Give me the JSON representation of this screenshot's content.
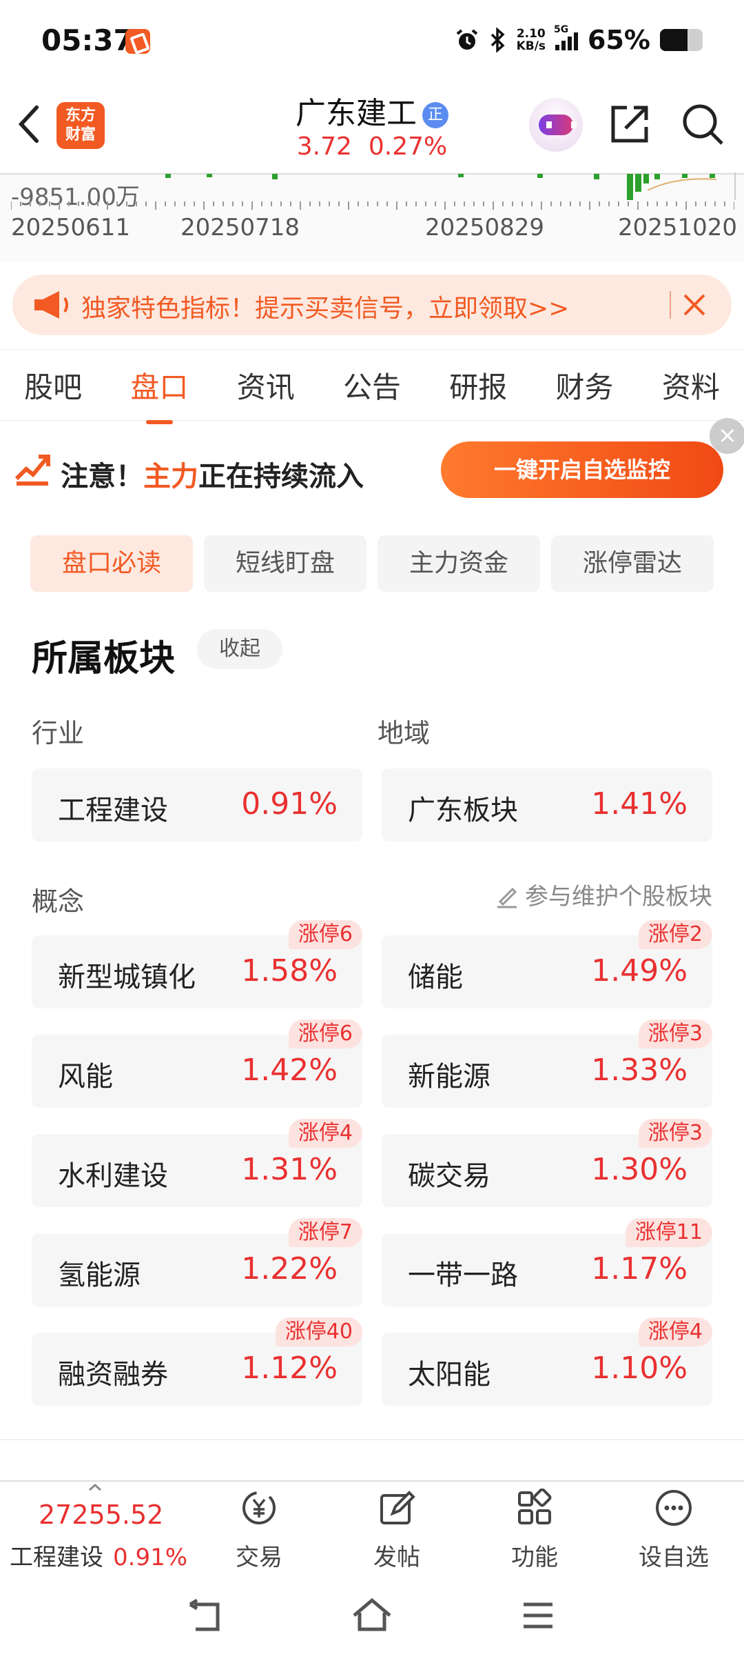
{
  "status_bar": {
    "time": "05:37",
    "net_speed_value": "2.10",
    "net_speed_unit": "KB/s",
    "network": "5G",
    "battery": "65%",
    "battery_level": 0.65
  },
  "header": {
    "logo_line1": "东方",
    "logo_line2": "财富",
    "stock_name": "广东建工",
    "cert_badge": "正",
    "price": "3.72",
    "change_pct": "0.27%"
  },
  "chart_strip": {
    "value_label": "-9851.00万",
    "dates": [
      "20250611",
      "20250718",
      "20250829",
      "20251020"
    ]
  },
  "banner": {
    "text": "独家特色指标！提示买卖信号，立即领取>>"
  },
  "tabs": [
    {
      "label": "股吧",
      "active": false
    },
    {
      "label": "盘口",
      "active": true
    },
    {
      "label": "资讯",
      "active": false
    },
    {
      "label": "公告",
      "active": false
    },
    {
      "label": "研报",
      "active": false
    },
    {
      "label": "财务",
      "active": false
    },
    {
      "label": "资料",
      "active": false
    }
  ],
  "notice": {
    "prefix": "注意！",
    "highlight": "主力",
    "suffix": "正在持续流入",
    "button": "一键开启自选监控"
  },
  "sub_tabs": [
    {
      "label": "盘口必读",
      "active": true
    },
    {
      "label": "短线盯盘",
      "active": false
    },
    {
      "label": "主力资金",
      "active": false
    },
    {
      "label": "涨停雷达",
      "active": false
    }
  ],
  "sectors": {
    "title": "所属板块",
    "collapse": "收起",
    "industry_label": "行业",
    "region_label": "地域",
    "industry": {
      "name": "工程建设",
      "pct": "0.91%"
    },
    "region": {
      "name": "广东板块",
      "pct": "1.41%"
    },
    "concept_label": "概念",
    "maintain_link": "参与维护个股板块",
    "concepts": [
      {
        "name": "新型城镇化",
        "pct": "1.58%",
        "badge": "涨停6"
      },
      {
        "name": "储能",
        "pct": "1.49%",
        "badge": "涨停2"
      },
      {
        "name": "风能",
        "pct": "1.42%",
        "badge": "涨停6"
      },
      {
        "name": "新能源",
        "pct": "1.33%",
        "badge": "涨停3"
      },
      {
        "name": "水利建设",
        "pct": "1.31%",
        "badge": "涨停4"
      },
      {
        "name": "碳交易",
        "pct": "1.30%",
        "badge": "涨停3"
      },
      {
        "name": "氢能源",
        "pct": "1.22%",
        "badge": "涨停7"
      },
      {
        "name": "一带一路",
        "pct": "1.17%",
        "badge": "涨停11"
      },
      {
        "name": "融资融券",
        "pct": "1.12%",
        "badge": "涨停40"
      },
      {
        "name": "太阳能",
        "pct": "1.10%",
        "badge": "涨停4"
      }
    ]
  },
  "bottom_bar": {
    "index_value": "27255.52",
    "index_name": "工程建设",
    "index_pct": "0.91%",
    "buttons": [
      {
        "label": "交易"
      },
      {
        "label": "发帖"
      },
      {
        "label": "功能"
      },
      {
        "label": "设自选"
      }
    ]
  },
  "colors": {
    "accent": "#f25a23",
    "up": "#e93030"
  }
}
